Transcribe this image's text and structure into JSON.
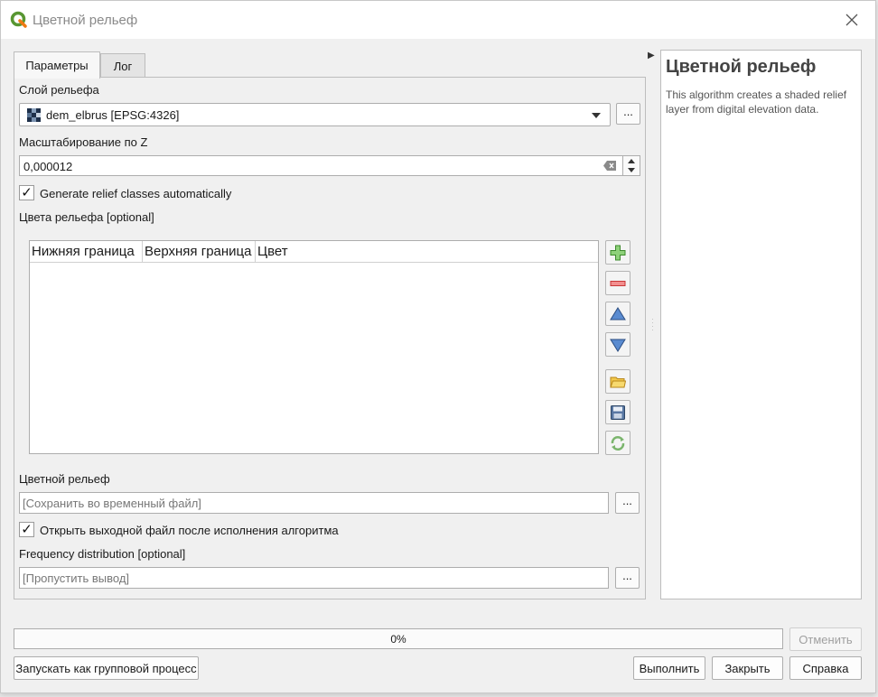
{
  "window": {
    "title": "Цветной рельеф",
    "accent_color": "#589632"
  },
  "tabs": [
    {
      "label": "Параметры",
      "active": true
    },
    {
      "label": "Лог",
      "active": false
    }
  ],
  "params": {
    "relief_layer": {
      "label": "Слой рельефа",
      "value": "dem_elbrus [EPSG:4326]",
      "browse_label": "..."
    },
    "z_scale": {
      "label": "Масштабирование по Z",
      "value": "0,000012"
    },
    "auto_classes": {
      "label": "Generate relief classes automatically",
      "checked": true,
      "mark": "✓"
    },
    "relief_colors": {
      "label": "Цвета рельефа [optional]",
      "columns": [
        "Нижняя граница",
        "Верхняя граница",
        "Цвет"
      ],
      "rows": []
    },
    "output": {
      "label": "Цветной рельеф",
      "placeholder": "[Сохранить во временный файл]",
      "browse_label": "..."
    },
    "open_output": {
      "label": "Открыть выходной файл после исполнения алгоритма",
      "checked": true,
      "mark": "✓"
    },
    "freq_dist": {
      "label": "Frequency distribution [optional]",
      "placeholder": "[Пропустить вывод]",
      "browse_label": "..."
    }
  },
  "table_tools": [
    {
      "name": "add-icon"
    },
    {
      "name": "remove-icon"
    },
    {
      "name": "move-up-icon"
    },
    {
      "name": "move-down-icon"
    },
    {
      "name": "load-icon"
    },
    {
      "name": "save-icon"
    },
    {
      "name": "refresh-icon"
    }
  ],
  "help": {
    "title": "Цветной рельеф",
    "description": "This algorithm creates a shaded relief layer from digital elevation data."
  },
  "progress": {
    "value": 0,
    "text": "0%"
  },
  "buttons": {
    "cancel": "Отменить",
    "batch": "Запускать как групповой процесс",
    "run": "Выполнить",
    "close": "Закрыть",
    "help": "Справка"
  }
}
